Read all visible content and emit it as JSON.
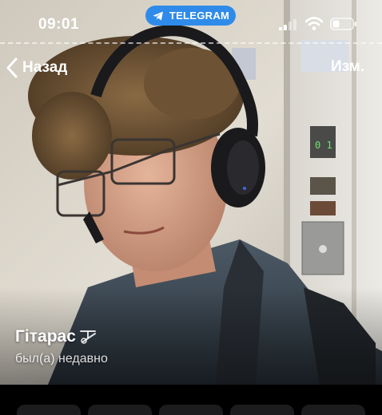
{
  "status_bar": {
    "time": "09:01",
    "app_pill_label": "TELEGRAM",
    "app_pill_color": "#2f8bea",
    "signal_icon": "cellular-signal-icon",
    "wifi_icon": "wifi-icon",
    "battery_icon": "battery-icon"
  },
  "nav": {
    "back_label": "Назад",
    "edit_label": "Изм."
  },
  "profile": {
    "name": "Гітарас",
    "name_badge_icon": "emoji-status-icon",
    "status": "был(а) недавно"
  },
  "actions": {
    "count": 5
  }
}
